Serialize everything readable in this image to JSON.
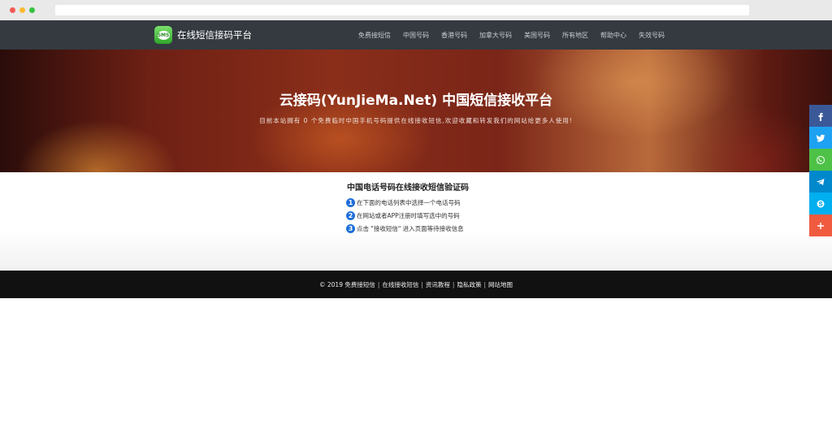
{
  "brand": {
    "name": "在线短信接码平台",
    "logo_text": "SMS"
  },
  "nav": {
    "items": [
      "免费接短信",
      "中国号码",
      "香港号码",
      "加拿大号码",
      "美国号码",
      "所有地区",
      "帮助中心",
      "失效号码"
    ]
  },
  "hero": {
    "title": "云接码(YunJieMa.Net) 中国短信接收平台",
    "subtitle": "目前本站拥有 0 个免费临时中国手机号码提供在线接收短信,欢迎收藏和转发我们的网站给更多人使用!"
  },
  "guide": {
    "title": "中国电话号码在线接收短信验证码",
    "steps": [
      {
        "num": "1",
        "text": "在下面的电话列表中选择一个电话号码"
      },
      {
        "num": "2",
        "text": "在网站或者APP注册时填写选中的号码"
      },
      {
        "num": "3",
        "text": "点击 \"接收短信\" 进入页面等待接收信息"
      }
    ]
  },
  "footer": {
    "copyright": "© 2019 免费接短信",
    "links": [
      "在线接收短信",
      "资讯教程",
      "隐私政策",
      "网站地图"
    ],
    "separator": "|"
  },
  "share": [
    {
      "icon": "facebook-icon",
      "color": "#3b5998"
    },
    {
      "icon": "twitter-icon",
      "color": "#1da1f2"
    },
    {
      "icon": "whatsapp-icon",
      "color": "#4dc247"
    },
    {
      "icon": "telegram-icon",
      "color": "#0088cc"
    },
    {
      "icon": "skype-icon",
      "color": "#00aff0"
    },
    {
      "icon": "more-plus-icon",
      "color": "#f05b3f"
    }
  ]
}
